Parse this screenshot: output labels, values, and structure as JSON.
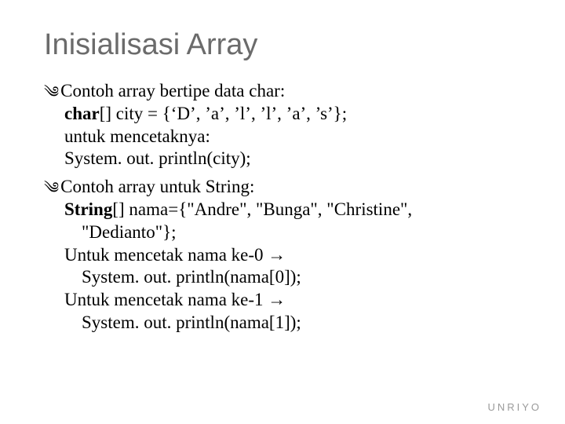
{
  "title": "Inisialisasi Array",
  "bullet1": "Contoh array bertipe data char:",
  "sub1a_bold": "char",
  "sub1a_rest": "[] city = {‘D’, ’a’, ’l’, ’l’, ’a’, ’s’};",
  "sub1b": "untuk mencetaknya:",
  "sub1c": "System. out. println(city);",
  "bullet2": "Contoh array untuk String:",
  "sub2a_bold": "String",
  "sub2a_rest": "[] nama={\"Andre\", \"Bunga\", \"Christine\",",
  "sub2a_cont": "\"Dedianto\"};",
  "sub2b": "Untuk mencetak nama ke-0 →",
  "sub2b_cont": "System. out. println(nama[0]);",
  "sub2c": "Untuk mencetak nama ke-1 →",
  "sub2c_cont": "System. out. println(nama[1]);",
  "footer": "UNRIYO",
  "bullet_glyph": "༄"
}
